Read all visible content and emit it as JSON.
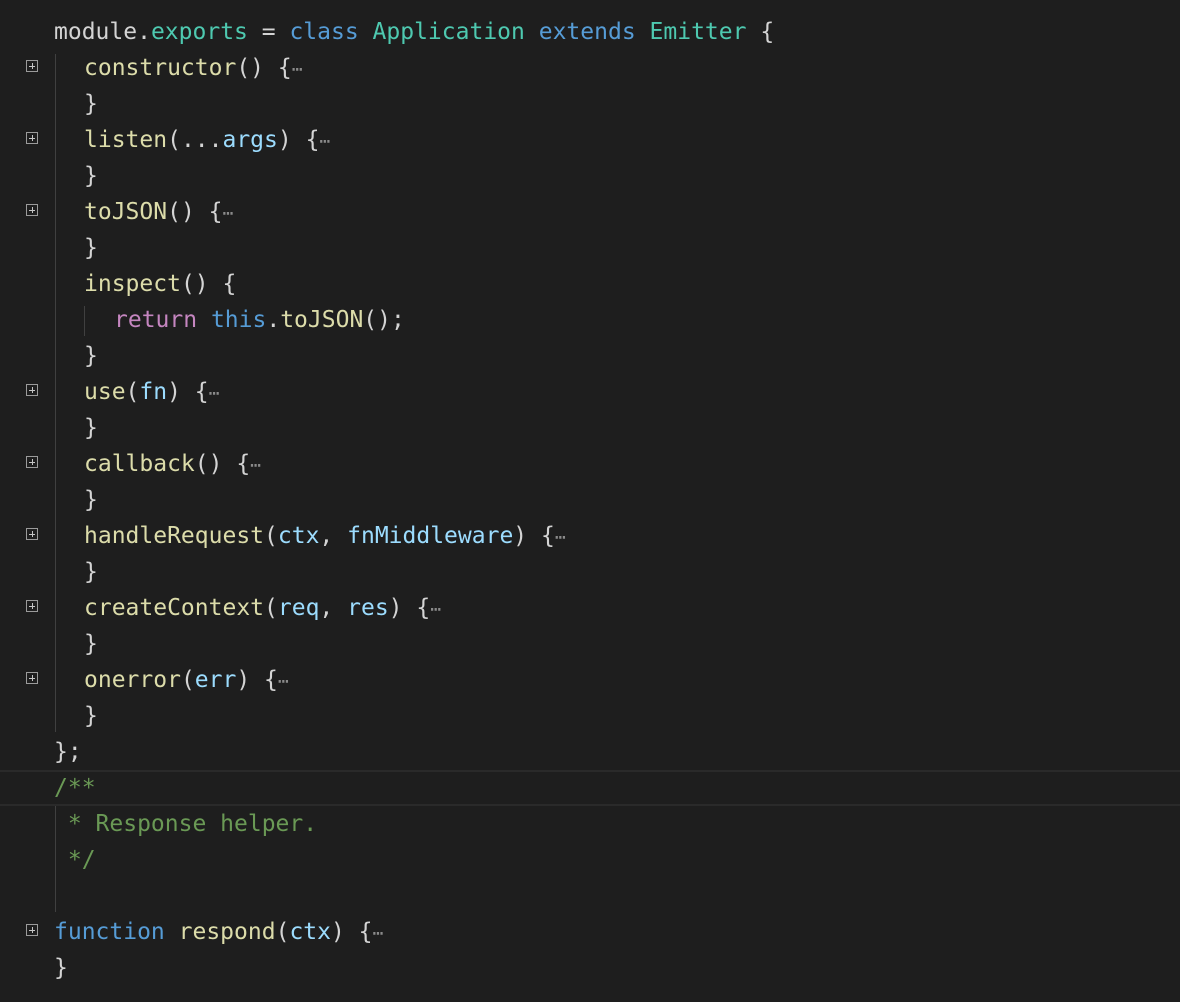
{
  "colors": {
    "background": "#1e1e1e",
    "keyword": "#569cd6",
    "control_keyword": "#c586c0",
    "function": "#dcdcaa",
    "type": "#4ec9b0",
    "variable": "#9cdcfe",
    "comment": "#6a9955",
    "plain": "#d4d4d4"
  },
  "icons": {
    "fold": "fold-expand-icon",
    "collapsed": "ellipsis-icon"
  },
  "lines": [
    {
      "indent": 0,
      "fold": false,
      "tokens": [
        {
          "t": "module",
          "c": "pl"
        },
        {
          "t": ".",
          "c": "pl"
        },
        {
          "t": "exports",
          "c": "prop"
        },
        {
          "t": " = ",
          "c": "pl"
        },
        {
          "t": "class",
          "c": "k-blue"
        },
        {
          "t": " ",
          "c": "pl"
        },
        {
          "t": "Application",
          "c": "ty"
        },
        {
          "t": " ",
          "c": "pl"
        },
        {
          "t": "extends",
          "c": "k-blue"
        },
        {
          "t": " ",
          "c": "pl"
        },
        {
          "t": "Emitter",
          "c": "ty"
        },
        {
          "t": " {",
          "c": "pl"
        }
      ]
    },
    {
      "indent": 1,
      "fold": true,
      "tokens": [
        {
          "t": "constructor",
          "c": "fn"
        },
        {
          "t": "() {",
          "c": "pl"
        }
      ]
    },
    {
      "indent": 1,
      "fold": false,
      "tokens": [
        {
          "t": "}",
          "c": "pl"
        }
      ]
    },
    {
      "indent": 1,
      "fold": true,
      "tokens": [
        {
          "t": "listen",
          "c": "fn"
        },
        {
          "t": "(...",
          "c": "pl"
        },
        {
          "t": "args",
          "c": "va"
        },
        {
          "t": ") {",
          "c": "pl"
        }
      ]
    },
    {
      "indent": 1,
      "fold": false,
      "tokens": [
        {
          "t": "}",
          "c": "pl"
        }
      ]
    },
    {
      "indent": 1,
      "fold": true,
      "tokens": [
        {
          "t": "toJSON",
          "c": "fn"
        },
        {
          "t": "() {",
          "c": "pl"
        }
      ]
    },
    {
      "indent": 1,
      "fold": false,
      "tokens": [
        {
          "t": "}",
          "c": "pl"
        }
      ]
    },
    {
      "indent": 1,
      "fold": false,
      "tokens": [
        {
          "t": "inspect",
          "c": "fn"
        },
        {
          "t": "() {",
          "c": "pl"
        }
      ]
    },
    {
      "indent": 2,
      "fold": false,
      "tokens": [
        {
          "t": "return",
          "c": "k-pink"
        },
        {
          "t": " ",
          "c": "pl"
        },
        {
          "t": "this",
          "c": "k-blue"
        },
        {
          "t": ".",
          "c": "pl"
        },
        {
          "t": "toJSON",
          "c": "fn"
        },
        {
          "t": "();",
          "c": "pl"
        }
      ]
    },
    {
      "indent": 1,
      "fold": false,
      "tokens": [
        {
          "t": "}",
          "c": "pl"
        }
      ]
    },
    {
      "indent": 1,
      "fold": true,
      "tokens": [
        {
          "t": "use",
          "c": "fn"
        },
        {
          "t": "(",
          "c": "pl"
        },
        {
          "t": "fn",
          "c": "va"
        },
        {
          "t": ") {",
          "c": "pl"
        }
      ]
    },
    {
      "indent": 1,
      "fold": false,
      "tokens": [
        {
          "t": "}",
          "c": "pl"
        }
      ]
    },
    {
      "indent": 1,
      "fold": true,
      "tokens": [
        {
          "t": "callback",
          "c": "fn"
        },
        {
          "t": "() {",
          "c": "pl"
        }
      ]
    },
    {
      "indent": 1,
      "fold": false,
      "tokens": [
        {
          "t": "}",
          "c": "pl"
        }
      ]
    },
    {
      "indent": 1,
      "fold": true,
      "tokens": [
        {
          "t": "handleRequest",
          "c": "fn"
        },
        {
          "t": "(",
          "c": "pl"
        },
        {
          "t": "ctx",
          "c": "va"
        },
        {
          "t": ", ",
          "c": "pl"
        },
        {
          "t": "fnMiddleware",
          "c": "va"
        },
        {
          "t": ") {",
          "c": "pl"
        }
      ]
    },
    {
      "indent": 1,
      "fold": false,
      "tokens": [
        {
          "t": "}",
          "c": "pl"
        }
      ]
    },
    {
      "indent": 1,
      "fold": true,
      "tokens": [
        {
          "t": "createContext",
          "c": "fn"
        },
        {
          "t": "(",
          "c": "pl"
        },
        {
          "t": "req",
          "c": "va"
        },
        {
          "t": ", ",
          "c": "pl"
        },
        {
          "t": "res",
          "c": "va"
        },
        {
          "t": ") {",
          "c": "pl"
        }
      ]
    },
    {
      "indent": 1,
      "fold": false,
      "tokens": [
        {
          "t": "}",
          "c": "pl"
        }
      ]
    },
    {
      "indent": 1,
      "fold": true,
      "tokens": [
        {
          "t": "onerror",
          "c": "fn"
        },
        {
          "t": "(",
          "c": "pl"
        },
        {
          "t": "err",
          "c": "va"
        },
        {
          "t": ") {",
          "c": "pl"
        }
      ]
    },
    {
      "indent": 1,
      "fold": false,
      "tokens": [
        {
          "t": "}",
          "c": "pl"
        }
      ]
    },
    {
      "indent": 0,
      "fold": false,
      "tokens": [
        {
          "t": "};",
          "c": "pl"
        }
      ]
    },
    {
      "indent": 0,
      "fold": false,
      "current": true,
      "tokens": [
        {
          "t": "/**",
          "c": "cm"
        }
      ]
    },
    {
      "indent": 0,
      "fold": false,
      "tokens": [
        {
          "t": " * Response helper.",
          "c": "cm"
        }
      ]
    },
    {
      "indent": 0,
      "fold": false,
      "tokens": [
        {
          "t": " */",
          "c": "cm"
        }
      ]
    },
    {
      "indent": 0,
      "fold": false,
      "tokens": []
    },
    {
      "indent": 0,
      "fold": true,
      "tokens": [
        {
          "t": "function",
          "c": "k-blue"
        },
        {
          "t": " ",
          "c": "pl"
        },
        {
          "t": "respond",
          "c": "fn"
        },
        {
          "t": "(",
          "c": "pl"
        },
        {
          "t": "ctx",
          "c": "va"
        },
        {
          "t": ") {",
          "c": "pl"
        }
      ]
    },
    {
      "indent": 0,
      "fold": false,
      "tokens": [
        {
          "t": "}",
          "c": "pl"
        }
      ]
    }
  ]
}
